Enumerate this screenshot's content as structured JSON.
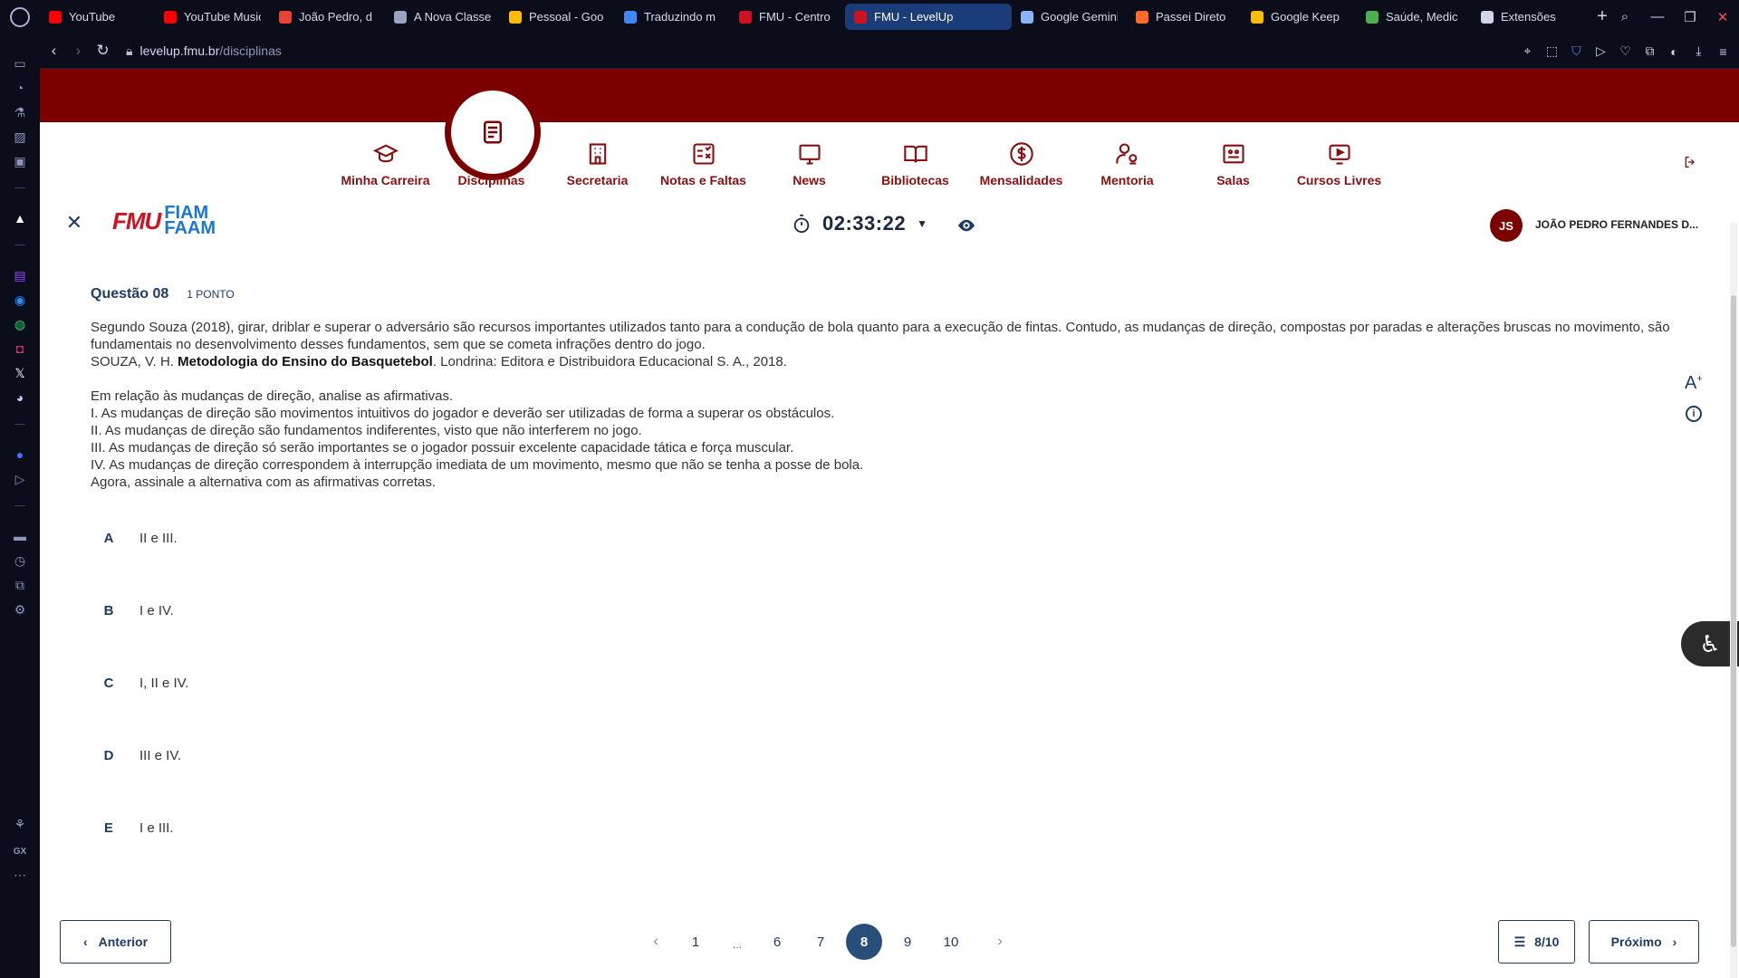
{
  "browser": {
    "tabs": [
      {
        "title": "YouTube",
        "icon": "youtube-icon",
        "color": "#ff0000",
        "active": false
      },
      {
        "title": "YouTube Music",
        "icon": "youtube-music-icon",
        "color": "#ff0000",
        "active": false
      },
      {
        "title": "João Pedro, d",
        "icon": "gmail-icon",
        "color": "#ea4335",
        "active": false
      },
      {
        "title": "A Nova Classe",
        "icon": "a-icon",
        "color": "#9aa3c0",
        "active": false
      },
      {
        "title": "Pessoal - Goo",
        "icon": "drive-icon",
        "color": "#fbbc04",
        "active": false
      },
      {
        "title": "Traduzindo m",
        "icon": "docs-icon",
        "color": "#4285f4",
        "active": false
      },
      {
        "title": "FMU - Centro",
        "icon": "fmu-icon",
        "color": "#d01220",
        "active": false
      },
      {
        "title": "FMU - LevelUp",
        "icon": "fmu-icon",
        "color": "#d01220",
        "active": true
      },
      {
        "title": "Google Gemini",
        "icon": "gemini-icon",
        "color": "#8ab4f8",
        "active": false
      },
      {
        "title": "Passei Direto",
        "icon": "passei-direto-icon",
        "color": "#ff6a2c",
        "active": false
      },
      {
        "title": "Google Keep",
        "icon": "keep-icon",
        "color": "#fbbc04",
        "active": false
      },
      {
        "title": "Saúde, Medic",
        "icon": "health-icon",
        "color": "#4caf50",
        "active": false
      },
      {
        "title": "Extensões",
        "icon": "extensions-icon",
        "color": "#cfd6ea",
        "active": false
      }
    ],
    "new_tab": "+",
    "url_host": "levelup.fmu.br",
    "url_path": "/disciplinas"
  },
  "nav": {
    "items": [
      {
        "label": "Minha Carreira",
        "icon": "graduation-cap-icon"
      },
      {
        "label": "Disciplinas",
        "icon": "document-icon",
        "active": true
      },
      {
        "label": "Secretaria",
        "icon": "building-icon"
      },
      {
        "label": "Notas e Faltas",
        "icon": "grades-icon"
      },
      {
        "label": "News",
        "icon": "monitor-icon"
      },
      {
        "label": "Bibliotecas",
        "icon": "book-icon"
      },
      {
        "label": "Mensalidades",
        "icon": "dollar-icon"
      },
      {
        "label": "Mentoria",
        "icon": "mentor-icon"
      },
      {
        "label": "Salas",
        "icon": "classroom-icon"
      },
      {
        "label": "Cursos Livres",
        "icon": "video-icon"
      }
    ]
  },
  "header": {
    "logo_fmu": "FMU",
    "logo_fiam": "FIAM",
    "logo_faam": "FAAM",
    "timer": "02:33:22",
    "avatar_initials": "JS",
    "user_name": "JOÃO PEDRO FERNANDES D..."
  },
  "question": {
    "title": "Questão 08",
    "points": "1 PONTO",
    "intro": "Segundo Souza (2018), girar, driblar e superar o adversário são recursos importantes utilizados tanto para a condução de bola quanto para a execução de fintas. Contudo, as mudanças de direção, compostas por paradas e alterações bruscas no movimento, são fundamentais no desenvolvimento desses fundamentos, sem que se cometa infrações dentro do jogo.",
    "ref_author": "SOUZA, V. H. ",
    "ref_title": "Metodologia do Ensino do Basquetebol",
    "ref_rest": ". Londrina: Editora e Distribuidora Educacional S. A., 2018.",
    "lines": [
      "Em relação às mudanças de direção, analise as afirmativas.",
      "I. As mudanças de direção são movimentos intuitivos do jogador e deverão ser utilizadas de forma a superar os obstáculos.",
      "II. As mudanças de direção são fundamentos indiferentes, visto que não interferem no jogo.",
      "III. As mudanças de direção só serão importantes se o jogador possuir excelente capacidade tática e força muscular.",
      "IV. As mudanças de direção correspondem à interrupção imediata de um movimento, mesmo que não se tenha a posse de bola.",
      "Agora, assinale a alternativa com as afirmativas corretas."
    ],
    "options": [
      {
        "letter": "A",
        "text": "II e III."
      },
      {
        "letter": "B",
        "text": "I e IV."
      },
      {
        "letter": "C",
        "text": "I, II e IV."
      },
      {
        "letter": "D",
        "text": "III e IV."
      },
      {
        "letter": "E",
        "text": "I e III."
      }
    ]
  },
  "footer": {
    "prev_label": "Anterior",
    "next_label": "Próximo",
    "count_label": "8/10",
    "pages": [
      "1",
      "...",
      "6",
      "7",
      "8",
      "9",
      "10"
    ],
    "current_page": "8"
  },
  "colors": {
    "brand_red": "#7d0000",
    "nav_text": "#8a0f10",
    "primary_blue": "#1f3a66",
    "page_active": "#284f7a"
  }
}
